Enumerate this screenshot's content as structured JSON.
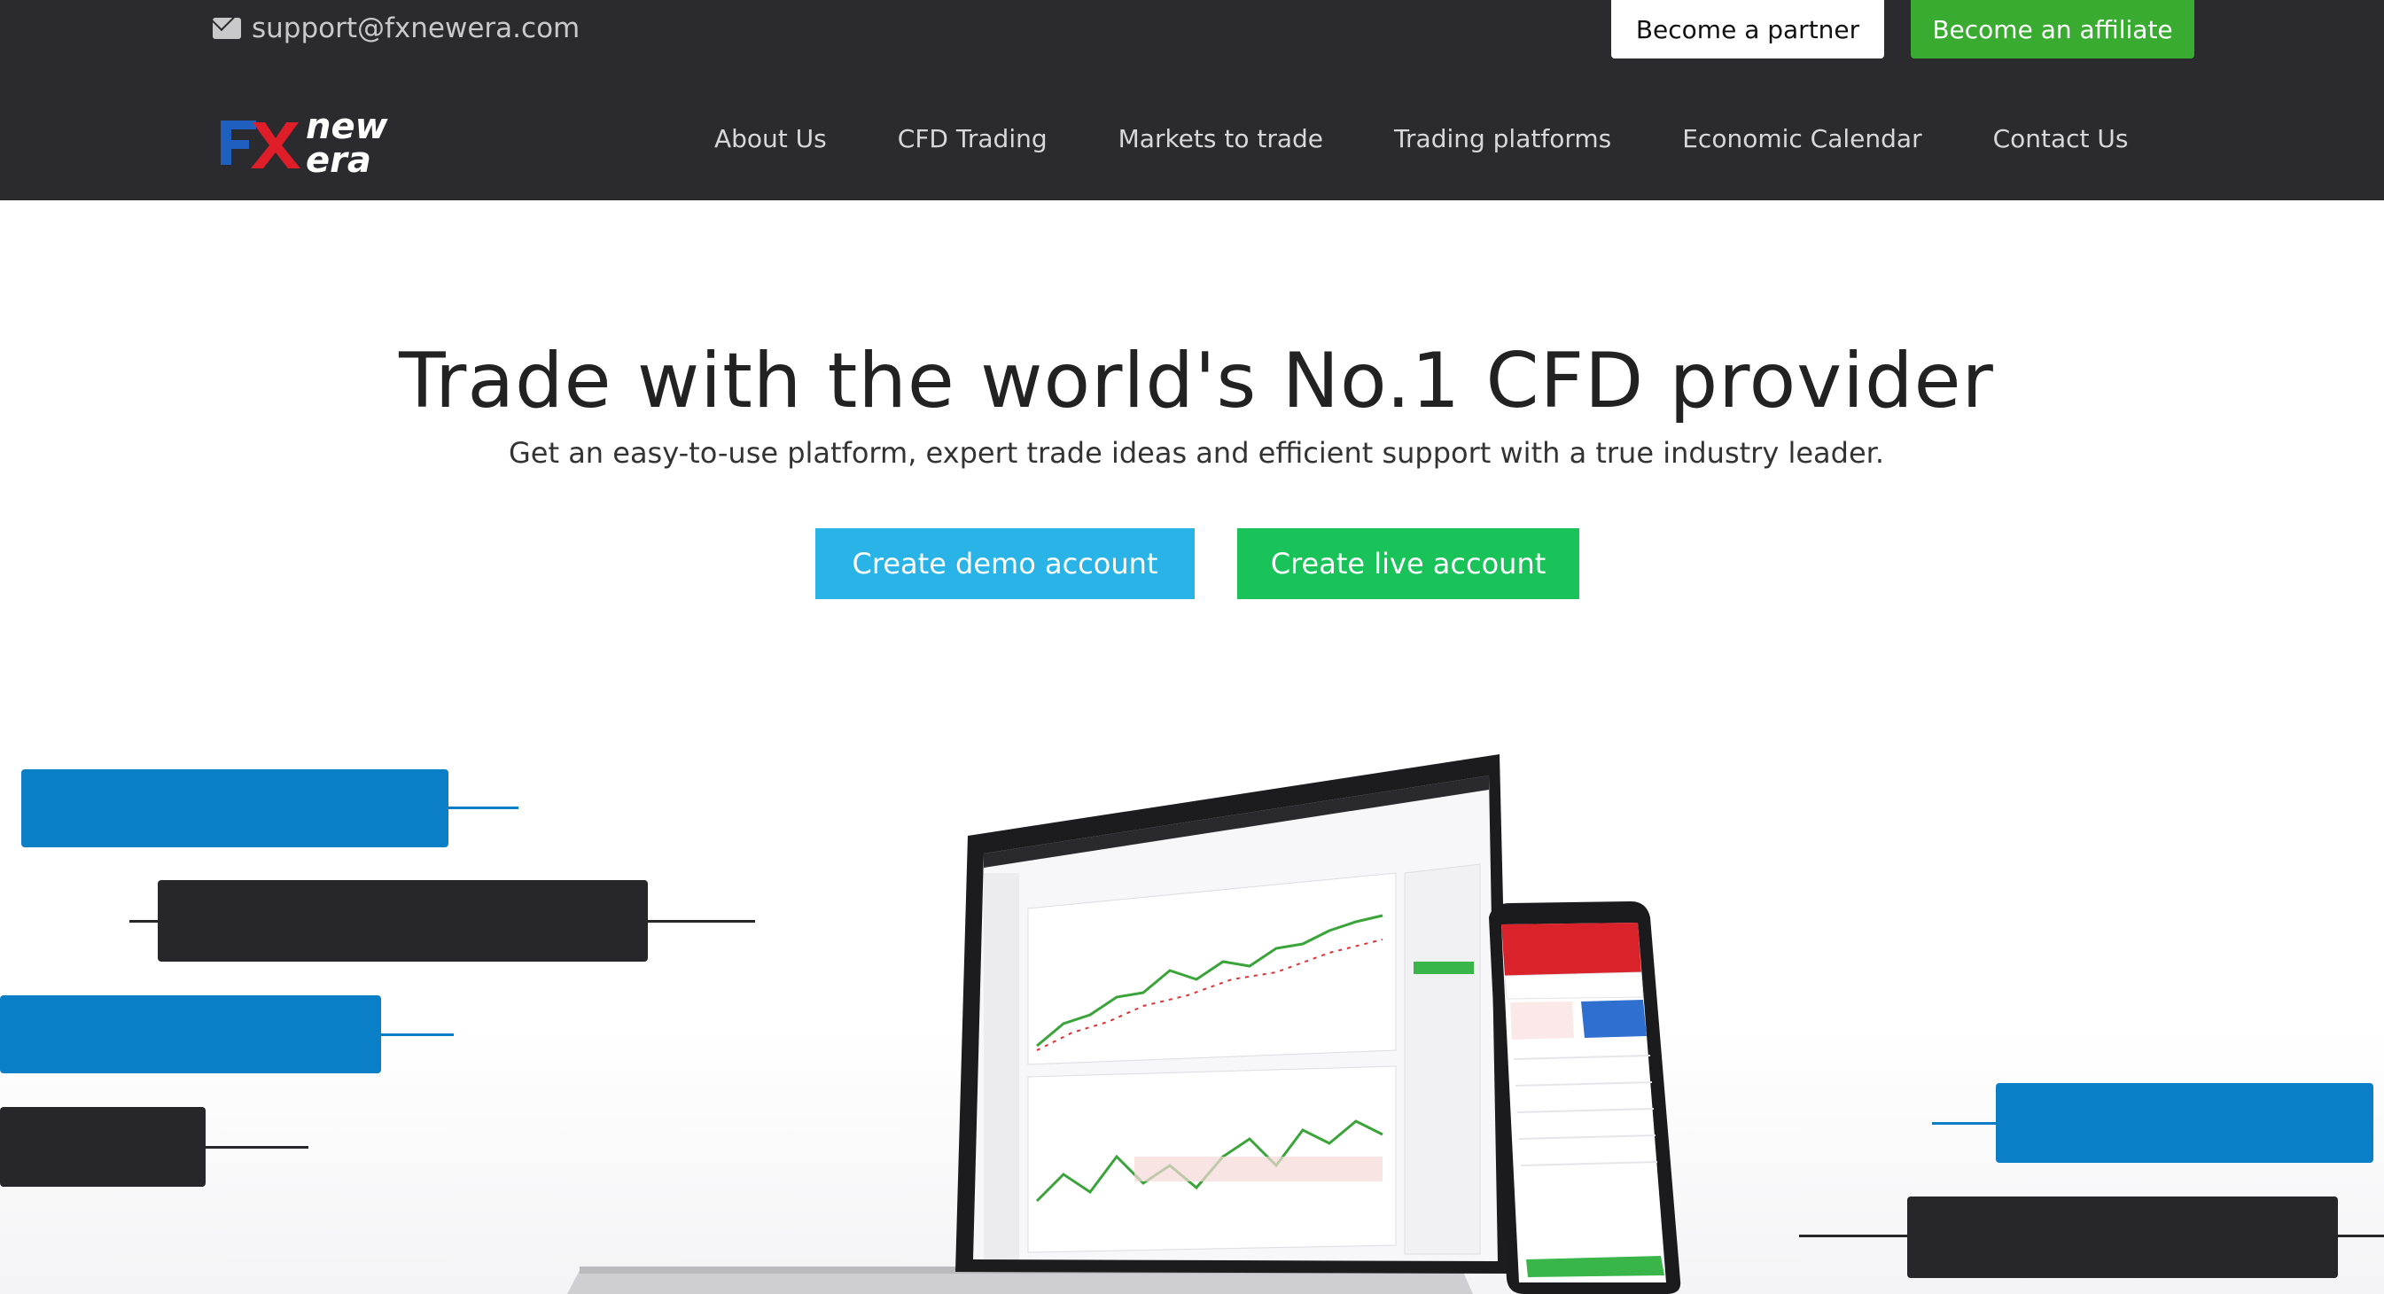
{
  "topbar": {
    "email": "support@fxnewera.com",
    "partner_label": "Become a partner",
    "affiliate_label": "Become an affiliate"
  },
  "logo": {
    "mark": "FX",
    "line1": "new",
    "line2": "era"
  },
  "nav": {
    "items": [
      {
        "label": "About Us"
      },
      {
        "label": "CFD Trading"
      },
      {
        "label": "Markets to trade"
      },
      {
        "label": "Trading platforms"
      },
      {
        "label": "Economic Calendar"
      },
      {
        "label": "Contact Us"
      }
    ]
  },
  "hero": {
    "title": "Trade with the world's No.1 CFD provider",
    "subtitle": "Get an easy-to-use platform, expert trade ideas and efficient support with a true industry leader.",
    "demo_label": "Create demo account",
    "live_label": "Create live account"
  },
  "colors": {
    "header_bg": "#2b2a2f",
    "affiliate_green": "#3aab31",
    "demo_blue": "#2ab3e6",
    "live_green": "#19c35a",
    "candle_blue": "#0b7ec8",
    "candle_dark": "#26262b",
    "logo_red": "#e01e2a",
    "logo_blue": "#1f5fbf"
  },
  "icons": {
    "email": "envelope-icon"
  }
}
